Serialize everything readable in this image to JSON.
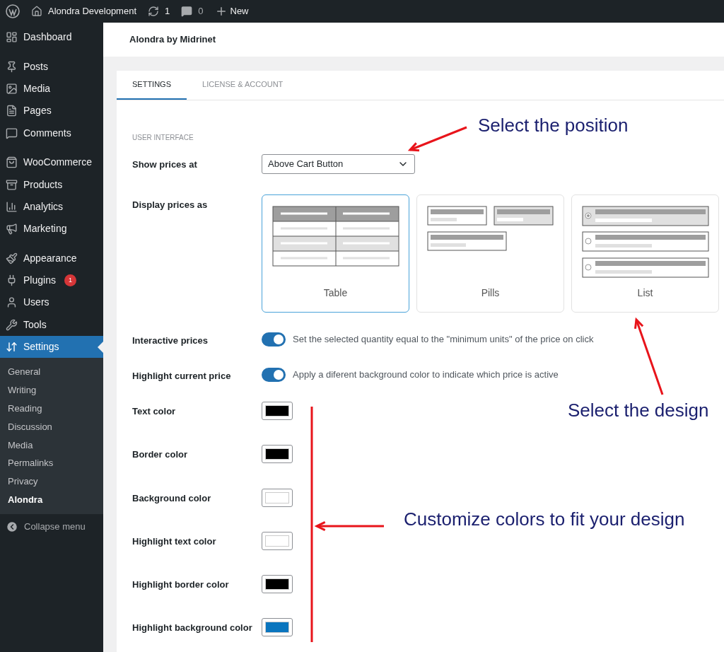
{
  "admin_bar": {
    "site": "Alondra Development",
    "updates": "1",
    "comments": "0",
    "new": "New"
  },
  "sidebar": {
    "groups": [
      [
        {
          "label": "Dashboard",
          "selected": false
        }
      ],
      [
        {
          "label": "Posts",
          "selected": false
        },
        {
          "label": "Media",
          "selected": false
        },
        {
          "label": "Pages",
          "selected": false
        },
        {
          "label": "Comments",
          "selected": false
        }
      ],
      [
        {
          "label": "WooCommerce",
          "selected": false
        },
        {
          "label": "Products",
          "selected": false
        },
        {
          "label": "Analytics",
          "selected": false
        },
        {
          "label": "Marketing",
          "selected": false
        }
      ],
      [
        {
          "label": "Appearance",
          "selected": false
        },
        {
          "label": "Plugins",
          "selected": false,
          "badge": "1"
        },
        {
          "label": "Users",
          "selected": false
        },
        {
          "label": "Tools",
          "selected": false
        },
        {
          "label": "Settings",
          "selected": true
        }
      ]
    ],
    "submenu": [
      {
        "label": "General",
        "selected": false
      },
      {
        "label": "Writing",
        "selected": false
      },
      {
        "label": "Reading",
        "selected": false
      },
      {
        "label": "Discussion",
        "selected": false
      },
      {
        "label": "Media",
        "selected": false
      },
      {
        "label": "Permalinks",
        "selected": false
      },
      {
        "label": "Privacy",
        "selected": false
      },
      {
        "label": "Alondra",
        "selected": true
      }
    ],
    "collapse": "Collapse menu"
  },
  "page_title": "Alondra by Midrinet",
  "tabs": [
    {
      "label": "SETTINGS",
      "selected": true
    },
    {
      "label": "LICENSE & ACCOUNT",
      "selected": false
    }
  ],
  "section_heading": "USER INTERFACE",
  "show_prices": {
    "label": "Show prices at",
    "value": "Above Cart Button"
  },
  "display_prices": {
    "label": "Display prices as",
    "options": [
      {
        "kind": "table",
        "label": "Table",
        "selected": true
      },
      {
        "kind": "pills",
        "label": "Pills",
        "selected": false
      },
      {
        "kind": "list",
        "label": "List",
        "selected": false
      }
    ]
  },
  "toggles": [
    {
      "label": "Interactive prices",
      "on": true,
      "description": "Set the selected quantity equal to the \"minimum units\" of the price on click"
    },
    {
      "label": "Highlight current price",
      "on": true,
      "description": "Apply a diferent background color to indicate which price is active"
    }
  ],
  "colors": [
    {
      "label": "Text color",
      "color": "#000000"
    },
    {
      "label": "Border color",
      "color": "#000000"
    },
    {
      "label": "Background color",
      "color": "#ffffff"
    },
    {
      "label": "Highlight text color",
      "color": "#ffffff"
    },
    {
      "label": "Highlight border color",
      "color": "#000000"
    },
    {
      "label": "Highlight background color",
      "color": "#0a75be"
    }
  ],
  "annotations": [
    {
      "text": "Select the position"
    },
    {
      "text": "Select the design"
    },
    {
      "text": "Customize colors to fit your design"
    }
  ]
}
